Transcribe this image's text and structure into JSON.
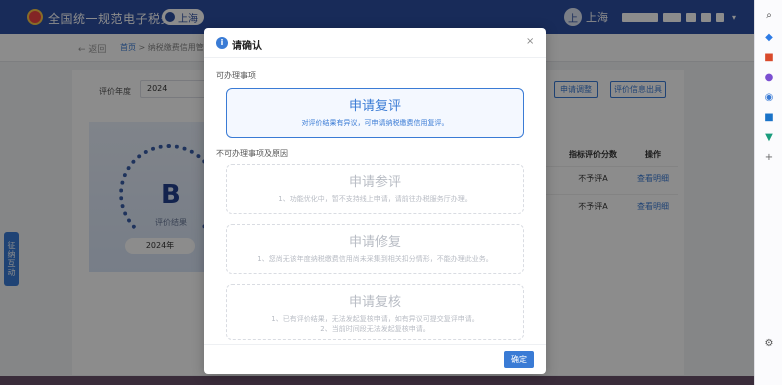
{
  "header": {
    "site_title": "全国统一规范电子税务局",
    "region": "上海",
    "user_name": "上海",
    "user_initial": "上"
  },
  "subheader": {
    "back": "← 返回",
    "home": "首页",
    "path": " > 纳税缴费信用管理"
  },
  "main": {
    "year_label": "评价年度",
    "year_value": "2024",
    "adjust_button": "申请调整",
    "report_button": "评价信息出具",
    "grade": "B",
    "grade_caption": "评价结果",
    "grade_year": "2024年",
    "table_headers": {
      "fragment": "准",
      "score": "指标评价分数",
      "op": "操作"
    },
    "rows": [
      {
        "score": "不予评A",
        "op": "查看明细"
      },
      {
        "score": "不予评A",
        "op": "查看明细"
      }
    ]
  },
  "side_tab": "征纳互动",
  "modal": {
    "title": "请确认",
    "available_label": "可办理事项",
    "unavailable_label": "不可办理事项及原因",
    "available_option": {
      "title": "申请复评",
      "desc": "对评价结果有异议，可申请纳税缴费信用复评。"
    },
    "disabled_options": [
      {
        "title": "申请参评",
        "lines": [
          "1、功能优化中，暂不支持线上申请，请前往办税服务厅办理。"
        ]
      },
      {
        "title": "申请修复",
        "lines": [
          "1、您尚无该年度纳税缴费信用尚未采集到相关扣分情形，不能办理此业务。"
        ]
      },
      {
        "title": "申请复核",
        "lines": [
          "1、已有评价结果，无法发起复核申请，如有异议可提交复评申请。",
          "2、当前时间段无法发起复核申请。"
        ]
      }
    ],
    "ok_button": "确定"
  },
  "colors": {
    "header_bg": "#2d4fa3",
    "accent": "#3a7bd5"
  },
  "browser_sidebar_icons": [
    "search-icon",
    "tag-icon",
    "toolbox-icon",
    "people-icon",
    "circle-icon",
    "outlook-icon",
    "shopping-icon",
    "plus-icon",
    "gear-icon"
  ]
}
